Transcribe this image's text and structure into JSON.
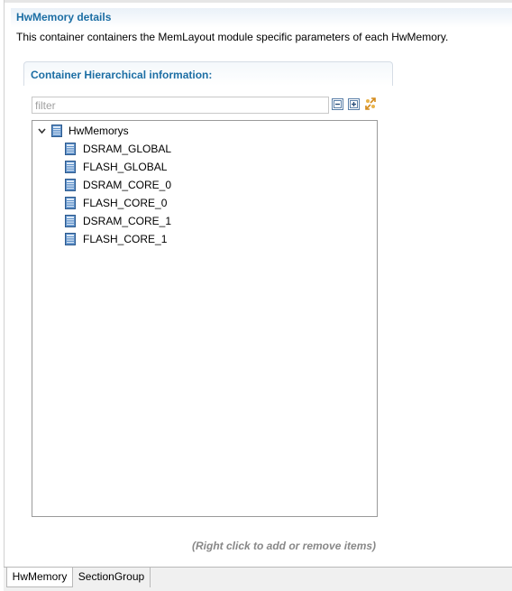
{
  "section": {
    "title": "HwMemory details",
    "description": "This container containers the MemLayout module specific parameters of each HwMemory."
  },
  "group": {
    "title": "Container Hierarchical information:"
  },
  "filter": {
    "placeholder": "filter",
    "value": ""
  },
  "toolbar": {
    "collapse_icon": "collapse-all-icon",
    "expand_icon": "expand-all-icon",
    "link_icon": "link-with-editor-icon"
  },
  "tree": {
    "root": {
      "label": "HwMemorys",
      "expanded": true,
      "icon": "container-icon"
    },
    "children": [
      {
        "label": "DSRAM_GLOBAL",
        "icon": "container-icon"
      },
      {
        "label": "FLASH_GLOBAL",
        "icon": "container-icon"
      },
      {
        "label": "DSRAM_CORE_0",
        "icon": "container-icon"
      },
      {
        "label": "FLASH_CORE_0",
        "icon": "container-icon"
      },
      {
        "label": "DSRAM_CORE_1",
        "icon": "container-icon"
      },
      {
        "label": "FLASH_CORE_1",
        "icon": "container-icon"
      }
    ]
  },
  "hint": "(Right click to add or remove items)",
  "tabs": [
    {
      "label": "HwMemory",
      "active": true
    },
    {
      "label": "SectionGroup",
      "active": false
    }
  ],
  "colors": {
    "section_title": "#1c6ea4",
    "hint_text": "#888888",
    "icon_blue": "#3f78b5"
  }
}
